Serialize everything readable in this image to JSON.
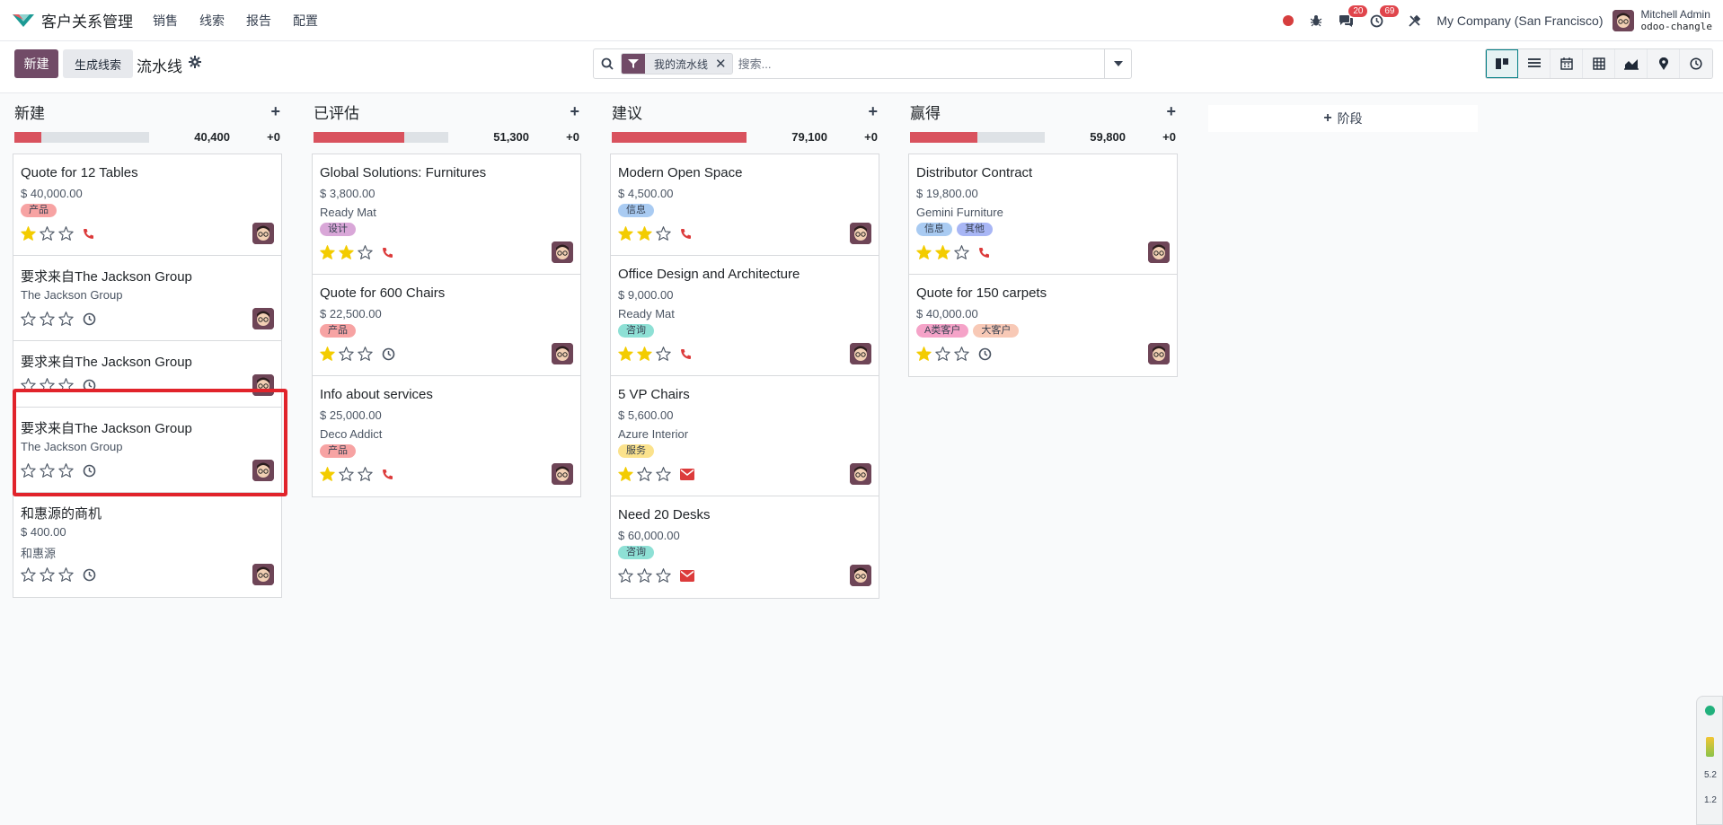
{
  "navbar": {
    "app_title": "客户关系管理",
    "menu": [
      "销售",
      "线索",
      "报告",
      "配置"
    ],
    "messages_count": "20",
    "activities_count": "69",
    "company": "My Company (San Francisco)",
    "user_name": "Mitchell Admin",
    "database": "odoo-changle",
    "icons": [
      "recording-dot-icon",
      "bug-icon",
      "chat-icon",
      "clock-icon",
      "tools-icon"
    ]
  },
  "control_panel": {
    "new_label": "新建",
    "generate_label": "生成线索",
    "breadcrumb": "流水线",
    "facet_label": "我的流水线",
    "search_placeholder": "搜索...",
    "views": [
      "kanban",
      "list",
      "calendar",
      "pivot",
      "graph",
      "map",
      "activity"
    ],
    "active_view": "kanban"
  },
  "colors": {
    "brand": "#714b67",
    "progress_red": "#d9525e",
    "highlight": "#e1232b",
    "star_filled": "#f3cc00"
  },
  "columns": [
    {
      "name": "新建",
      "total": "40,400",
      "delta": "+0",
      "progress": 0.2,
      "cards": [
        {
          "title": "Quote for 12 Tables",
          "amount": "$ 40,000.00",
          "tags": [
            {
              "label": "产品",
              "color": "#f7a3a3"
            }
          ],
          "stars": 1,
          "activity": "phone"
        },
        {
          "title": "要求来自The Jackson Group",
          "company": "The Jackson Group",
          "stars": 0,
          "activity": "clock"
        },
        {
          "title": "要求来自The Jackson Group",
          "stars": 0,
          "activity": "clock"
        },
        {
          "title": "要求来自The Jackson Group",
          "company": "The Jackson Group",
          "stars": 0,
          "activity": "clock"
        },
        {
          "title": "和惠源的商机",
          "amount": "$ 400.00",
          "company": "和惠源",
          "stars": 0,
          "activity": "clock"
        }
      ]
    },
    {
      "name": "已评估",
      "total": "51,300",
      "delta": "+0",
      "progress": 0.67,
      "cards": [
        {
          "title": "Global Solutions: Furnitures",
          "amount": "$ 3,800.00",
          "company": "Ready Mat",
          "tags": [
            {
              "label": "设计",
              "color": "#d9a7d8"
            }
          ],
          "stars": 2,
          "activity": "phone"
        },
        {
          "title": "Quote for 600 Chairs",
          "amount": "$ 22,500.00",
          "tags": [
            {
              "label": "产品",
              "color": "#f7a3a3"
            }
          ],
          "stars": 1,
          "activity": "clock"
        },
        {
          "title": "Info about services",
          "amount": "$ 25,000.00",
          "company": "Deco Addict",
          "tags": [
            {
              "label": "产品",
              "color": "#f7a3a3"
            }
          ],
          "stars": 1,
          "activity": "phone"
        }
      ]
    },
    {
      "name": "建议",
      "total": "79,100",
      "delta": "+0",
      "progress": 1.0,
      "cards": [
        {
          "title": "Modern Open Space",
          "amount": "$ 4,500.00",
          "tags": [
            {
              "label": "信息",
              "color": "#a9cbf2"
            }
          ],
          "stars": 2,
          "activity": "phone"
        },
        {
          "title": "Office Design and Architecture",
          "amount": "$ 9,000.00",
          "company": "Ready Mat",
          "tags": [
            {
              "label": "咨询",
              "color": "#8ee0d5"
            }
          ],
          "stars": 2,
          "activity": "phone"
        },
        {
          "title": "5 VP Chairs",
          "amount": "$ 5,600.00",
          "company": "Azure Interior",
          "tags": [
            {
              "label": "服务",
              "color": "#fbe28c"
            }
          ],
          "stars": 1,
          "activity": "email"
        },
        {
          "title": "Need 20 Desks",
          "amount": "$ 60,000.00",
          "tags": [
            {
              "label": "咨询",
              "color": "#8ee0d5"
            }
          ],
          "stars": 0,
          "activity": "email"
        }
      ]
    },
    {
      "name": "赢得",
      "total": "59,800",
      "delta": "+0",
      "progress": 0.5,
      "cards": [
        {
          "title": "Distributor Contract",
          "amount": "$ 19,800.00",
          "company": "Gemini Furniture",
          "tags": [
            {
              "label": "信息",
              "color": "#a9cbf2"
            },
            {
              "label": "其他",
              "color": "#a8b6f5"
            }
          ],
          "stars": 2,
          "activity": "phone"
        },
        {
          "title": "Quote for 150 carpets",
          "amount": "$ 40,000.00",
          "tags": [
            {
              "label": "A类客户",
              "color": "#f5a3c8"
            },
            {
              "label": "大客户",
              "color": "#f8c9b6"
            }
          ],
          "stars": 1,
          "activity": "clock"
        }
      ]
    }
  ],
  "add_stage_label": "阶段",
  "widget": {
    "value1": "5.2",
    "value2": "1.2"
  }
}
